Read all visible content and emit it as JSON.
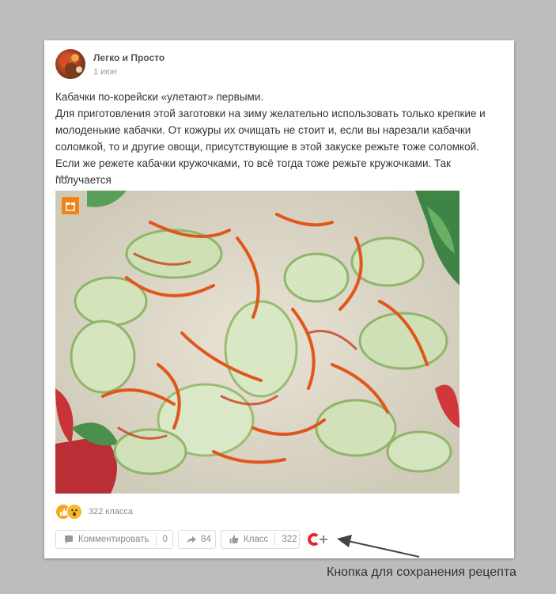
{
  "post": {
    "author": "Легко и Просто",
    "date": "1 июн",
    "text_lines": [
      "Кабачки по-корейски «улетают» первыми.",
      "Для приготовления этой заготовки на зиму желательно использовать только крепкие и молоденькие кабачки. От кожуры их очищать не стоит и, если вы нарезали кабачки соломкой, то и другие овощи, присутствующие в этой закуске режьте тоже соломкой. Если же режете кабачки кружочками, то всё тогда тоже режьте кружочками. Так получается"
    ],
    "more": "•••"
  },
  "reactions": {
    "count_text": "322 класса"
  },
  "actions": {
    "comment_label": "Комментировать",
    "comment_count": "0",
    "share_count": "84",
    "class_label": "Класс",
    "class_count": "322"
  },
  "annotation": {
    "label": "Кнопка для сохранения рецепта"
  },
  "colors": {
    "accent_orange": "#f0841a",
    "save_red": "#e3262b",
    "text": "#333333",
    "muted": "#888888"
  }
}
